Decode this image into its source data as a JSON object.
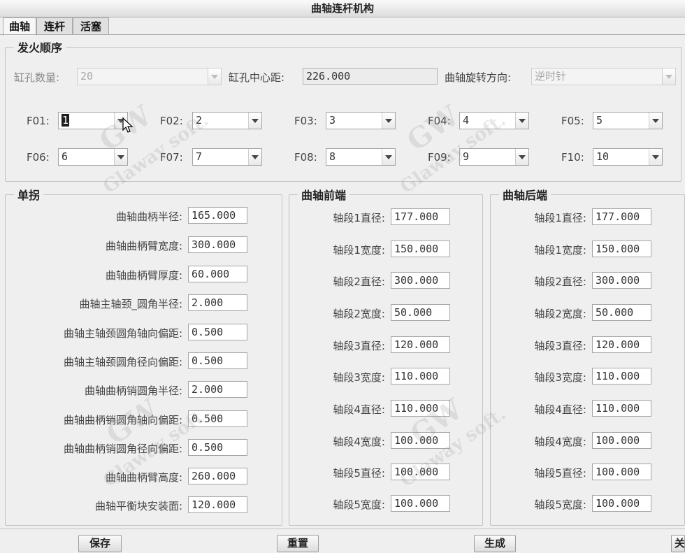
{
  "window": {
    "title": "曲轴连杆机构"
  },
  "tabs": [
    {
      "label": "曲轴",
      "active": true
    },
    {
      "label": "连杆",
      "active": false
    },
    {
      "label": "活塞",
      "active": false
    }
  ],
  "firing": {
    "legend": "发火顺序",
    "bore_count_label": "缸孔数量:",
    "bore_count_value": "20",
    "bore_distance_label": "缸孔中心距:",
    "bore_distance_value": "226.000",
    "rotation_label": "曲轴旋转方向:",
    "rotation_value": "逆时针",
    "order": [
      {
        "label": "F01:",
        "value": "1"
      },
      {
        "label": "F02:",
        "value": "2"
      },
      {
        "label": "F03:",
        "value": "3"
      },
      {
        "label": "F04:",
        "value": "4"
      },
      {
        "label": "F05:",
        "value": "5"
      },
      {
        "label": "F06:",
        "value": "6"
      },
      {
        "label": "F07:",
        "value": "7"
      },
      {
        "label": "F08:",
        "value": "8"
      },
      {
        "label": "F09:",
        "value": "9"
      },
      {
        "label": "F10:",
        "value": "10"
      }
    ]
  },
  "single_throw": {
    "legend": "单拐",
    "fields": [
      {
        "label": "曲轴曲柄半径:",
        "value": "165.000"
      },
      {
        "label": "曲轴曲柄臂宽度:",
        "value": "300.000"
      },
      {
        "label": "曲轴曲柄臂厚度:",
        "value": "60.000"
      },
      {
        "label": "曲轴主轴颈_圆角半径:",
        "value": "2.000"
      },
      {
        "label": "曲轴主轴颈圆角轴向偏距:",
        "value": "0.500"
      },
      {
        "label": "曲轴主轴颈圆角径向偏距:",
        "value": "0.500"
      },
      {
        "label": "曲轴曲柄销圆角半径:",
        "value": "2.000"
      },
      {
        "label": "曲轴曲柄销圆角轴向偏距:",
        "value": "0.500"
      },
      {
        "label": "曲轴曲柄销圆角径向偏距:",
        "value": "0.500"
      },
      {
        "label": "曲轴曲柄臂高度:",
        "value": "260.000"
      },
      {
        "label": "曲轴平衡块安装面:",
        "value": "120.000"
      }
    ]
  },
  "front_end": {
    "legend": "曲轴前端",
    "fields": [
      {
        "label": "轴段1直径:",
        "value": "177.000"
      },
      {
        "label": "轴段1宽度:",
        "value": "150.000"
      },
      {
        "label": "轴段2直径:",
        "value": "300.000"
      },
      {
        "label": "轴段2宽度:",
        "value": "50.000"
      },
      {
        "label": "轴段3直径:",
        "value": "120.000"
      },
      {
        "label": "轴段3宽度:",
        "value": "110.000"
      },
      {
        "label": "轴段4直径:",
        "value": "110.000"
      },
      {
        "label": "轴段4宽度:",
        "value": "100.000"
      },
      {
        "label": "轴段5直径:",
        "value": "100.000"
      },
      {
        "label": "轴段5宽度:",
        "value": "100.000"
      }
    ]
  },
  "rear_end": {
    "legend": "曲轴后端",
    "fields": [
      {
        "label": "轴段1直径:",
        "value": "177.000"
      },
      {
        "label": "轴段1宽度:",
        "value": "150.000"
      },
      {
        "label": "轴段2直径:",
        "value": "300.000"
      },
      {
        "label": "轴段2宽度:",
        "value": "50.000"
      },
      {
        "label": "轴段3直径:",
        "value": "120.000"
      },
      {
        "label": "轴段3宽度:",
        "value": "110.000"
      },
      {
        "label": "轴段4直径:",
        "value": "110.000"
      },
      {
        "label": "轴段4宽度:",
        "value": "100.000"
      },
      {
        "label": "轴段5直径:",
        "value": "100.000"
      },
      {
        "label": "轴段5宽度:",
        "value": "100.000"
      }
    ]
  },
  "buttons": {
    "save": "保存",
    "reset": "重置",
    "generate": "生成",
    "close": "关"
  },
  "watermark": {
    "logo": "GW",
    "text": "Glaway soft."
  },
  "icons": {
    "cursor": "mouse-pointer-icon",
    "dropdown": "chevron-down-icon"
  }
}
